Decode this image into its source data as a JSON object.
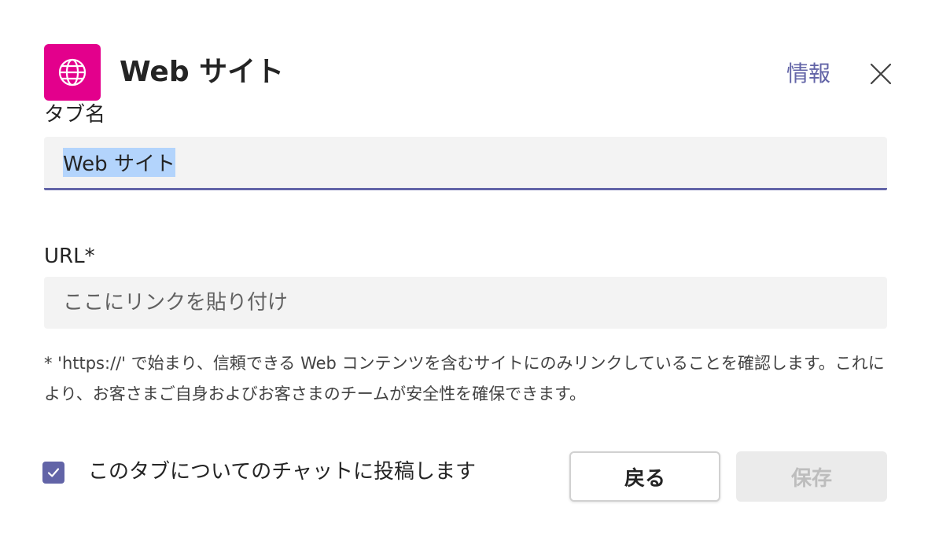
{
  "dialog": {
    "app_icon": "globe-icon",
    "title": "Web サイト",
    "info_link": "情報",
    "close_icon": "close-icon",
    "accent_color": "#6264a7",
    "icon_bg_color": "#e3008c"
  },
  "form": {
    "tab_name": {
      "label": "タブ名",
      "value": "Web サイト"
    },
    "url": {
      "label": "URL*",
      "value": "",
      "placeholder": "ここにリンクを貼り付け"
    },
    "help_text": "* 'https://' で始まり、信頼できる Web コンテンツを含むサイトにのみリンクしていることを確認します。これにより、お客さまご自身およびお客さまのチームが安全性を確保できます。"
  },
  "footer": {
    "post_to_chat": {
      "label": "このタブについてのチャットに投稿します",
      "checked": true
    },
    "back_label": "戻る",
    "save_label": "保存"
  }
}
